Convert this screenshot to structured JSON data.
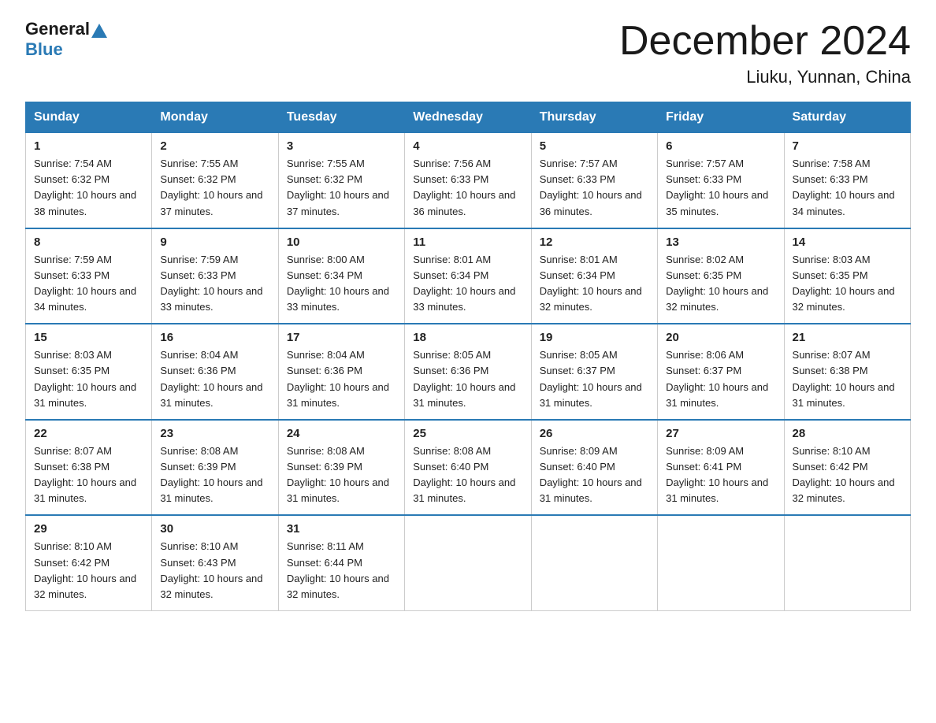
{
  "header": {
    "logo_general": "General",
    "logo_blue": "Blue",
    "month_title": "December 2024",
    "location": "Liuku, Yunnan, China"
  },
  "days_of_week": [
    "Sunday",
    "Monday",
    "Tuesday",
    "Wednesday",
    "Thursday",
    "Friday",
    "Saturday"
  ],
  "weeks": [
    [
      {
        "day": "1",
        "sunrise": "7:54 AM",
        "sunset": "6:32 PM",
        "daylight": "10 hours and 38 minutes."
      },
      {
        "day": "2",
        "sunrise": "7:55 AM",
        "sunset": "6:32 PM",
        "daylight": "10 hours and 37 minutes."
      },
      {
        "day": "3",
        "sunrise": "7:55 AM",
        "sunset": "6:32 PM",
        "daylight": "10 hours and 37 minutes."
      },
      {
        "day": "4",
        "sunrise": "7:56 AM",
        "sunset": "6:33 PM",
        "daylight": "10 hours and 36 minutes."
      },
      {
        "day": "5",
        "sunrise": "7:57 AM",
        "sunset": "6:33 PM",
        "daylight": "10 hours and 36 minutes."
      },
      {
        "day": "6",
        "sunrise": "7:57 AM",
        "sunset": "6:33 PM",
        "daylight": "10 hours and 35 minutes."
      },
      {
        "day": "7",
        "sunrise": "7:58 AM",
        "sunset": "6:33 PM",
        "daylight": "10 hours and 34 minutes."
      }
    ],
    [
      {
        "day": "8",
        "sunrise": "7:59 AM",
        "sunset": "6:33 PM",
        "daylight": "10 hours and 34 minutes."
      },
      {
        "day": "9",
        "sunrise": "7:59 AM",
        "sunset": "6:33 PM",
        "daylight": "10 hours and 33 minutes."
      },
      {
        "day": "10",
        "sunrise": "8:00 AM",
        "sunset": "6:34 PM",
        "daylight": "10 hours and 33 minutes."
      },
      {
        "day": "11",
        "sunrise": "8:01 AM",
        "sunset": "6:34 PM",
        "daylight": "10 hours and 33 minutes."
      },
      {
        "day": "12",
        "sunrise": "8:01 AM",
        "sunset": "6:34 PM",
        "daylight": "10 hours and 32 minutes."
      },
      {
        "day": "13",
        "sunrise": "8:02 AM",
        "sunset": "6:35 PM",
        "daylight": "10 hours and 32 minutes."
      },
      {
        "day": "14",
        "sunrise": "8:03 AM",
        "sunset": "6:35 PM",
        "daylight": "10 hours and 32 minutes."
      }
    ],
    [
      {
        "day": "15",
        "sunrise": "8:03 AM",
        "sunset": "6:35 PM",
        "daylight": "10 hours and 31 minutes."
      },
      {
        "day": "16",
        "sunrise": "8:04 AM",
        "sunset": "6:36 PM",
        "daylight": "10 hours and 31 minutes."
      },
      {
        "day": "17",
        "sunrise": "8:04 AM",
        "sunset": "6:36 PM",
        "daylight": "10 hours and 31 minutes."
      },
      {
        "day": "18",
        "sunrise": "8:05 AM",
        "sunset": "6:36 PM",
        "daylight": "10 hours and 31 minutes."
      },
      {
        "day": "19",
        "sunrise": "8:05 AM",
        "sunset": "6:37 PM",
        "daylight": "10 hours and 31 minutes."
      },
      {
        "day": "20",
        "sunrise": "8:06 AM",
        "sunset": "6:37 PM",
        "daylight": "10 hours and 31 minutes."
      },
      {
        "day": "21",
        "sunrise": "8:07 AM",
        "sunset": "6:38 PM",
        "daylight": "10 hours and 31 minutes."
      }
    ],
    [
      {
        "day": "22",
        "sunrise": "8:07 AM",
        "sunset": "6:38 PM",
        "daylight": "10 hours and 31 minutes."
      },
      {
        "day": "23",
        "sunrise": "8:08 AM",
        "sunset": "6:39 PM",
        "daylight": "10 hours and 31 minutes."
      },
      {
        "day": "24",
        "sunrise": "8:08 AM",
        "sunset": "6:39 PM",
        "daylight": "10 hours and 31 minutes."
      },
      {
        "day": "25",
        "sunrise": "8:08 AM",
        "sunset": "6:40 PM",
        "daylight": "10 hours and 31 minutes."
      },
      {
        "day": "26",
        "sunrise": "8:09 AM",
        "sunset": "6:40 PM",
        "daylight": "10 hours and 31 minutes."
      },
      {
        "day": "27",
        "sunrise": "8:09 AM",
        "sunset": "6:41 PM",
        "daylight": "10 hours and 31 minutes."
      },
      {
        "day": "28",
        "sunrise": "8:10 AM",
        "sunset": "6:42 PM",
        "daylight": "10 hours and 32 minutes."
      }
    ],
    [
      {
        "day": "29",
        "sunrise": "8:10 AM",
        "sunset": "6:42 PM",
        "daylight": "10 hours and 32 minutes."
      },
      {
        "day": "30",
        "sunrise": "8:10 AM",
        "sunset": "6:43 PM",
        "daylight": "10 hours and 32 minutes."
      },
      {
        "day": "31",
        "sunrise": "8:11 AM",
        "sunset": "6:44 PM",
        "daylight": "10 hours and 32 minutes."
      },
      null,
      null,
      null,
      null
    ]
  ]
}
